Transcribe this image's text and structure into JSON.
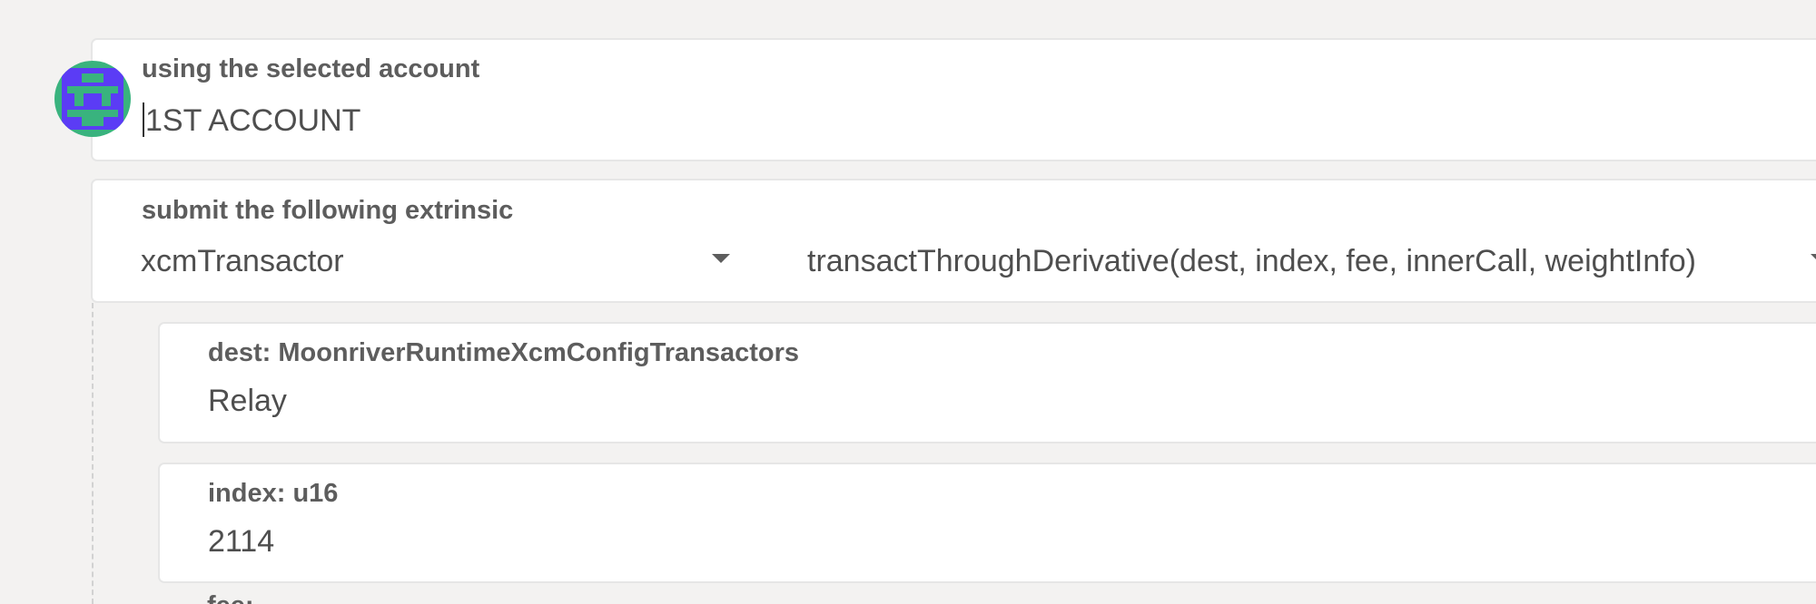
{
  "account": {
    "label": "using the selected account",
    "value": "1ST ACCOUNT"
  },
  "extrinsic": {
    "label": "submit the following extrinsic",
    "section": "xcmTransactor",
    "method": "transactThroughDerivative(dest, index, fee, innerCall, weightInfo)"
  },
  "params": [
    {
      "label": "dest: MoonriverRuntimeXcmConfigTransactors",
      "value": "Relay"
    },
    {
      "label": "index: u16",
      "value": "2114"
    }
  ],
  "next_param_stub": "fee: ...",
  "icons": {
    "avatar": "identicon-avatar",
    "section_dropdown": "chevron-down-icon",
    "method_dropdown": "chevron-down-icon"
  },
  "colors": {
    "background": "#f3f2f1",
    "card": "#ffffff",
    "border": "#e6e6e6",
    "identicon_blue": "#5b3cf5",
    "identicon_green": "#39b37e"
  }
}
